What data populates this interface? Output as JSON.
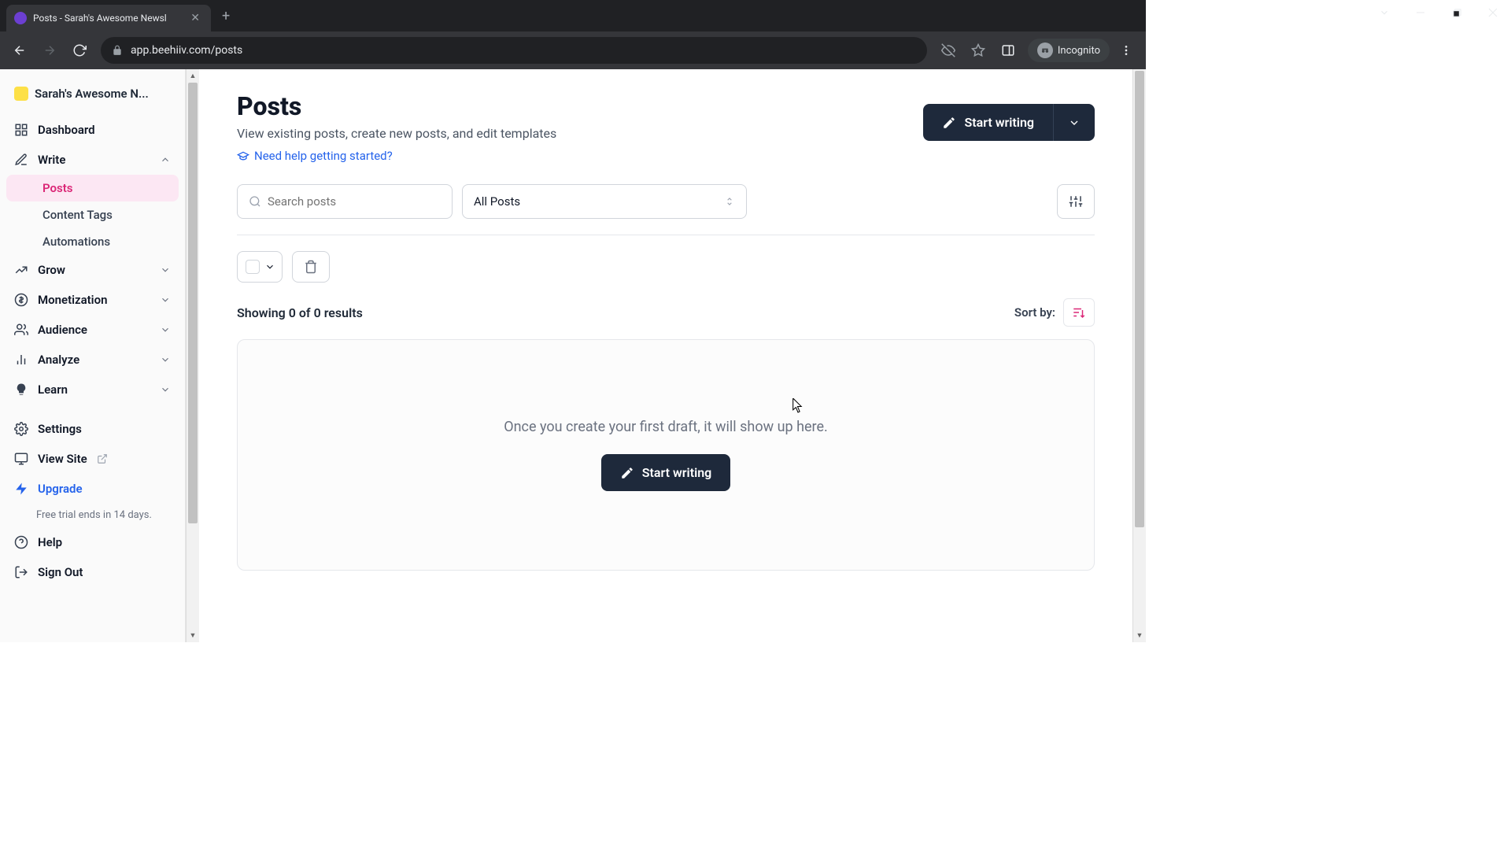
{
  "browser": {
    "tab_title": "Posts - Sarah's Awesome Newsl",
    "url": "app.beehiiv.com/posts",
    "incognito_label": "Incognito"
  },
  "workspace": {
    "name": "Sarah's Awesome N..."
  },
  "sidebar": {
    "dashboard": "Dashboard",
    "write": "Write",
    "write_children": {
      "posts": "Posts",
      "content_tags": "Content Tags",
      "automations": "Automations"
    },
    "grow": "Grow",
    "monetization": "Monetization",
    "audience": "Audience",
    "analyze": "Analyze",
    "learn": "Learn",
    "settings": "Settings",
    "view_site": "View Site",
    "upgrade": "Upgrade",
    "trial": "Free trial ends in 14 days.",
    "help": "Help",
    "sign_out": "Sign Out"
  },
  "page": {
    "title": "Posts",
    "description": "View existing posts, create new posts, and edit templates",
    "help_link": "Need help getting started?",
    "start_writing": "Start writing"
  },
  "toolbar": {
    "search_placeholder": "Search posts",
    "filter_value": "All Posts"
  },
  "results": {
    "showing": "Showing 0 of 0 results",
    "sort_by_label": "Sort by:"
  },
  "empty": {
    "message": "Once you create your first draft, it will show up here.",
    "cta": "Start writing"
  }
}
